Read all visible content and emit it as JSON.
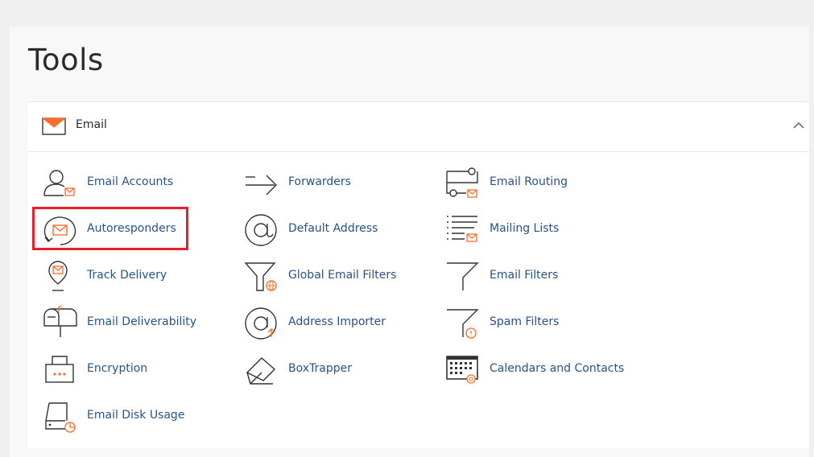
{
  "page": {
    "title": "Tools"
  },
  "section": {
    "label": "Email"
  },
  "colors": {
    "accent": "#ff6c2c",
    "link": "#295289",
    "icon_stroke": "#333333",
    "highlight": "#ee1c25"
  },
  "tools": [
    {
      "label": "Email Accounts",
      "icon": "email-accounts-icon"
    },
    {
      "label": "Forwarders",
      "icon": "forwarders-icon"
    },
    {
      "label": "Email Routing",
      "icon": "email-routing-icon"
    },
    {
      "label": "Autoresponders",
      "icon": "autoresponders-icon"
    },
    {
      "label": "Default Address",
      "icon": "default-address-icon"
    },
    {
      "label": "Mailing Lists",
      "icon": "mailing-lists-icon"
    },
    {
      "label": "Track Delivery",
      "icon": "track-delivery-icon"
    },
    {
      "label": "Global Email Filters",
      "icon": "global-email-filters-icon"
    },
    {
      "label": "Email Filters",
      "icon": "email-filters-icon"
    },
    {
      "label": "Email Deliverability",
      "icon": "email-deliverability-icon"
    },
    {
      "label": "Address Importer",
      "icon": "address-importer-icon"
    },
    {
      "label": "Spam Filters",
      "icon": "spam-filters-icon"
    },
    {
      "label": "Encryption",
      "icon": "encryption-icon"
    },
    {
      "label": "BoxTrapper",
      "icon": "boxtrapper-icon"
    },
    {
      "label": "Calendars and Contacts",
      "icon": "calendars-contacts-icon"
    },
    {
      "label": "Email Disk Usage",
      "icon": "email-disk-usage-icon"
    }
  ]
}
